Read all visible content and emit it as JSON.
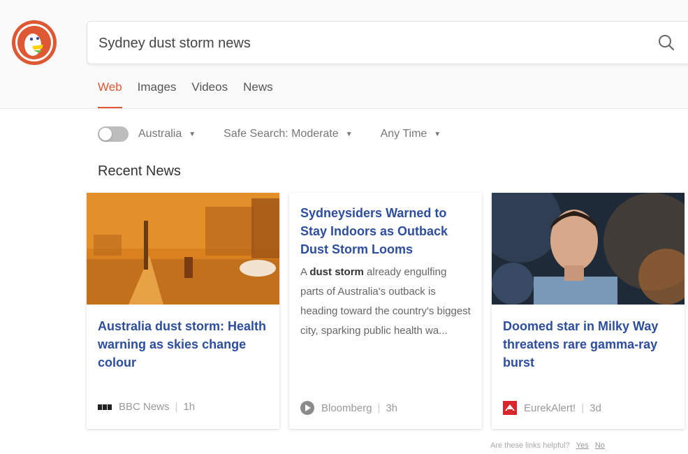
{
  "search": {
    "query": "Sydney dust storm news"
  },
  "tabs": [
    {
      "label": "Web",
      "active": true
    },
    {
      "label": "Images",
      "active": false
    },
    {
      "label": "Videos",
      "active": false
    },
    {
      "label": "News",
      "active": false
    }
  ],
  "filters": {
    "region": "Australia",
    "safe_search": "Safe Search: Moderate",
    "time": "Any Time"
  },
  "section_title": "Recent News",
  "cards": [
    {
      "title": "Australia dust storm: Health warning as skies change colour",
      "source": "BBC News",
      "age": "1h",
      "source_icon": "bbc-logo-icon"
    },
    {
      "title": "Sydneysiders Warned to Stay Indoors as Outback Dust Storm Looms",
      "snippet_prefix": "A ",
      "snippet_bold": "dust storm",
      "snippet_rest": " already engulfing parts of Australia's outback is heading toward the country's biggest city, sparking public health wa...",
      "source": "Bloomberg",
      "age": "3h",
      "source_icon": "bloomberg-logo-icon"
    },
    {
      "title": "Doomed star in Milky Way threatens rare gamma-ray burst",
      "source": "EurekAlert!",
      "age": "3d",
      "source_icon": "eurekalert-logo-icon"
    }
  ],
  "feedback": {
    "question": "Are these links helpful?",
    "yes": "Yes",
    "no": "No"
  },
  "colors": {
    "accent": "#de5833",
    "link": "#2d4d9e"
  }
}
